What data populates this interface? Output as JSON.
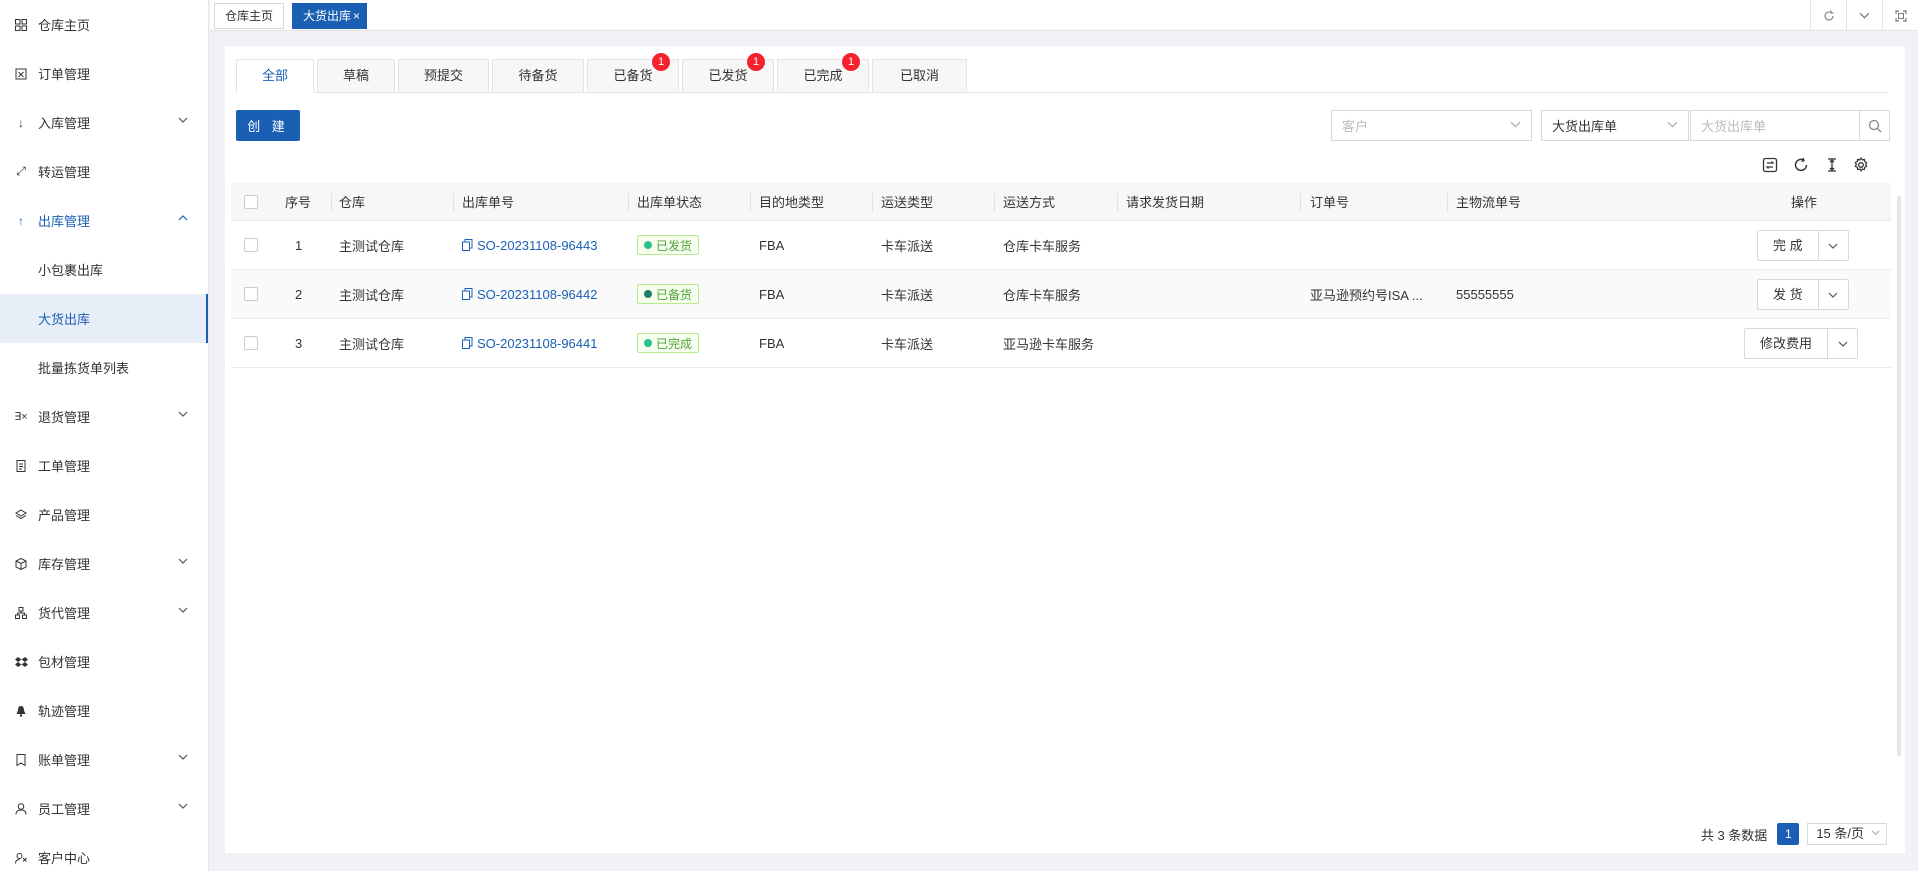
{
  "sidebar": {
    "items": [
      {
        "label": "仓库主页",
        "icon": "grid-icon",
        "arrow": ""
      },
      {
        "label": "订单管理",
        "icon": "order-icon",
        "arrow": ""
      },
      {
        "label": "入库管理",
        "icon": "arrow-down-icon",
        "arrow": "⌄"
      },
      {
        "label": "转运管理",
        "icon": "transfer-icon",
        "arrow": ""
      },
      {
        "label": "出库管理",
        "icon": "arrow-up-icon",
        "arrow": "⌃"
      },
      {
        "label": "小包裹出库",
        "icon": "",
        "arrow": ""
      },
      {
        "label": "大货出库",
        "icon": "",
        "arrow": ""
      },
      {
        "label": "批量拣货单列表",
        "icon": "",
        "arrow": ""
      },
      {
        "label": "退货管理",
        "icon": "return-icon",
        "arrow": "⌄"
      },
      {
        "label": "工单管理",
        "icon": "ticket-icon",
        "arrow": ""
      },
      {
        "label": "产品管理",
        "icon": "product-icon",
        "arrow": ""
      },
      {
        "label": "库存管理",
        "icon": "inventory-icon",
        "arrow": "⌄"
      },
      {
        "label": "货代管理",
        "icon": "forwarder-icon",
        "arrow": "⌄"
      },
      {
        "label": "包材管理",
        "icon": "package-icon",
        "arrow": ""
      },
      {
        "label": "轨迹管理",
        "icon": "bell-icon",
        "arrow": ""
      },
      {
        "label": "账单管理",
        "icon": "bill-icon",
        "arrow": "⌄"
      },
      {
        "label": "员工管理",
        "icon": "user-icon",
        "arrow": "⌄"
      },
      {
        "label": "客户中心",
        "icon": "customer-icon",
        "arrow": ""
      }
    ]
  },
  "topbar": {
    "tabs": [
      {
        "label": "仓库主页"
      },
      {
        "label": "大货出库"
      }
    ],
    "close_glyph": "×"
  },
  "status_tabs": [
    {
      "label": "全部",
      "badge": ""
    },
    {
      "label": "草稿",
      "badge": ""
    },
    {
      "label": "预提交",
      "badge": ""
    },
    {
      "label": "待备货",
      "badge": ""
    },
    {
      "label": "已备货",
      "badge": "1"
    },
    {
      "label": "已发货",
      "badge": "1"
    },
    {
      "label": "已完成",
      "badge": "1"
    },
    {
      "label": "已取消",
      "badge": ""
    }
  ],
  "toolbar": {
    "create_label": "创 建",
    "customer_placeholder": "客户",
    "order_type_value": "大货出库单",
    "search_placeholder": "大货出库单"
  },
  "table": {
    "headers": [
      "序号",
      "仓库",
      "出库单号",
      "出库单状态",
      "目的地类型",
      "运送类型",
      "运送方式",
      "请求发货日期",
      "订单号",
      "主物流单号",
      "操作"
    ],
    "rows": [
      {
        "no": "1",
        "warehouse": "主测试仓库",
        "order_no": "SO-20231108-96443",
        "status": "已发货",
        "status_color": "#2bbf8f",
        "dest_type": "FBA",
        "ship_type": "卡车派送",
        "ship_method": "仓库卡车服务",
        "req_date": "",
        "order_id": "",
        "tracking": "",
        "action": "完 成"
      },
      {
        "no": "2",
        "warehouse": "主测试仓库",
        "order_no": "SO-20231108-96442",
        "status": "已备货",
        "status_color": "#1f7a6b",
        "dest_type": "FBA",
        "ship_type": "卡车派送",
        "ship_method": "仓库卡车服务",
        "req_date": "",
        "order_id": "亚马逊预约号ISA ...",
        "tracking": "55555555",
        "action": "发 货"
      },
      {
        "no": "3",
        "warehouse": "主测试仓库",
        "order_no": "SO-20231108-96441",
        "status": "已完成",
        "status_color": "#2bbf8f",
        "dest_type": "FBA",
        "ship_type": "卡车派送",
        "ship_method": "亚马逊卡车服务",
        "req_date": "",
        "order_id": "",
        "tracking": "",
        "action": "修改费用"
      }
    ]
  },
  "pager": {
    "total_text": "共 3 条数据",
    "current_page": "1",
    "page_size": "15 条/页"
  }
}
